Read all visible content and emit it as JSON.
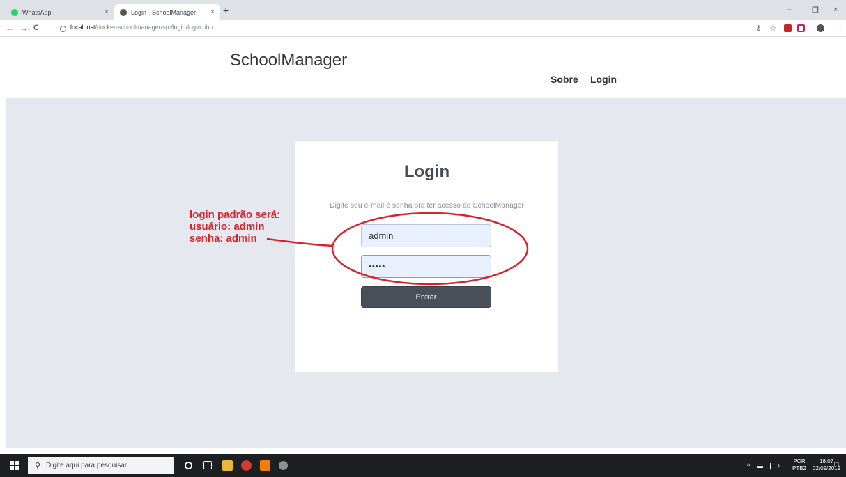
{
  "browser": {
    "tabs": [
      {
        "label": "WhatsApp",
        "close": "×",
        "active": false,
        "favicon_color": "#25d366"
      },
      {
        "label": "Login - SchoolManager",
        "close": "×",
        "active": true,
        "favicon_color": "#555555"
      }
    ],
    "new_tab": "+",
    "window_controls": {
      "minimize": "–",
      "restore": "❐",
      "close": "×"
    },
    "nav": {
      "back": "←",
      "forward": "→",
      "reload": "C"
    },
    "url_info": "i",
    "url_host": "localhost",
    "url_path": "/docker-schoolmanager/src/login/login.php",
    "toolbar_icons": {
      "key": "⚷",
      "star": "☆",
      "menu": "⋮"
    }
  },
  "site": {
    "brand": "SchoolManager",
    "nav": [
      {
        "label": "Sobre"
      },
      {
        "label": "Login"
      }
    ]
  },
  "login": {
    "title": "Login",
    "subtitle": "Digite seu e-mail e senha pra ter acesso ao SchoolManager",
    "username_value": "admin",
    "password_value": "•••••",
    "submit_label": "Entrar"
  },
  "annotation": {
    "lines": [
      "login padrão será:",
      "usuário: admin",
      "senha: admin"
    ],
    "color": "#d8232a"
  },
  "taskbar": {
    "search_placeholder": "Digite aqui para pesquisar",
    "lang_top": "POR",
    "lang_bottom": "PTB2",
    "time": "18:07",
    "date": "02/09/2019"
  }
}
